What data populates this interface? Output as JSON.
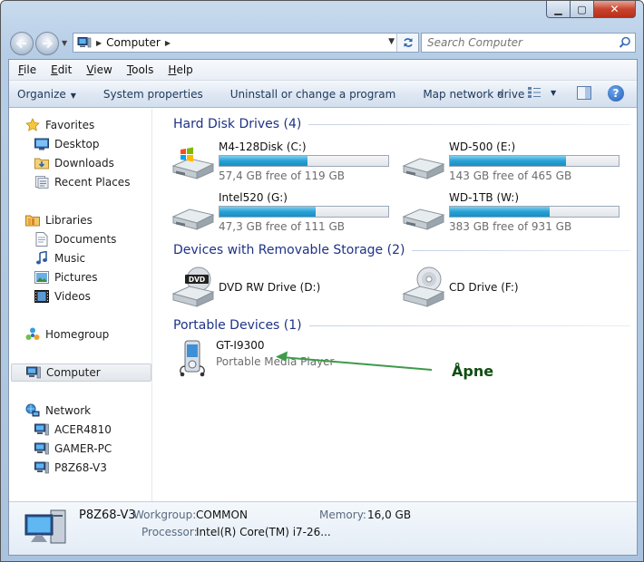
{
  "window": {
    "min_glyph": "▁",
    "max_glyph": "▢",
    "close_glyph": "✕"
  },
  "address": {
    "crumb": "Computer",
    "search_placeholder": "Search Computer"
  },
  "menu": [
    {
      "label": "File",
      "key": "F",
      "rest": "ile"
    },
    {
      "label": "Edit",
      "key": "E",
      "rest": "dit"
    },
    {
      "label": "View",
      "key": "V",
      "rest": "iew"
    },
    {
      "label": "Tools",
      "key": "T",
      "rest": "ools"
    },
    {
      "label": "Help",
      "key": "H",
      "rest": "elp"
    }
  ],
  "toolbar": {
    "organize": "Organize",
    "system_properties": "System properties",
    "uninstall": "Uninstall or change a program",
    "map_drive": "Map network drive",
    "more": "»",
    "help": "?"
  },
  "nav": {
    "favorites": "Favorites",
    "desktop": "Desktop",
    "downloads": "Downloads",
    "recent": "Recent Places",
    "libraries": "Libraries",
    "documents": "Documents",
    "music": "Music",
    "pictures": "Pictures",
    "videos": "Videos",
    "homegroup": "Homegroup",
    "computer": "Computer",
    "network": "Network",
    "net_items": [
      "ACER4810",
      "GAMER-PC",
      "P8Z68-V3"
    ]
  },
  "groups": {
    "hdd": "Hard Disk Drives (4)",
    "removable": "Devices with Removable Storage (2)",
    "portable": "Portable Devices (1)"
  },
  "drives": [
    {
      "name": "M4-128Disk (C:)",
      "free": "57,4 GB free of 119 GB",
      "used_fraction": 0.52
    },
    {
      "name": "WD-500 (E:)",
      "free": "143 GB free of 465 GB",
      "used_fraction": 0.69
    },
    {
      "name": "Intel520 (G:)",
      "free": "47,3 GB free of 111 GB",
      "used_fraction": 0.57
    },
    {
      "name": "WD-1TB (W:)",
      "free": "383 GB free of 931 GB",
      "used_fraction": 0.59
    }
  ],
  "removable": [
    {
      "name": "DVD RW Drive (D:)",
      "badge": "DVD"
    },
    {
      "name": "CD Drive (F:)"
    }
  ],
  "portable": {
    "name": "GT-I9300",
    "type": "Portable Media Player"
  },
  "annotation": {
    "text": "Åpne",
    "color": "#3f9a4a"
  },
  "details": {
    "computer_name": "P8Z68-V3",
    "workgroup_label": "Workgroup:",
    "workgroup": "COMMON",
    "memory_label": "Memory:",
    "memory": "16,0 GB",
    "processor_label": "Processor:",
    "processor": "Intel(R) Core(TM) i7-26..."
  }
}
